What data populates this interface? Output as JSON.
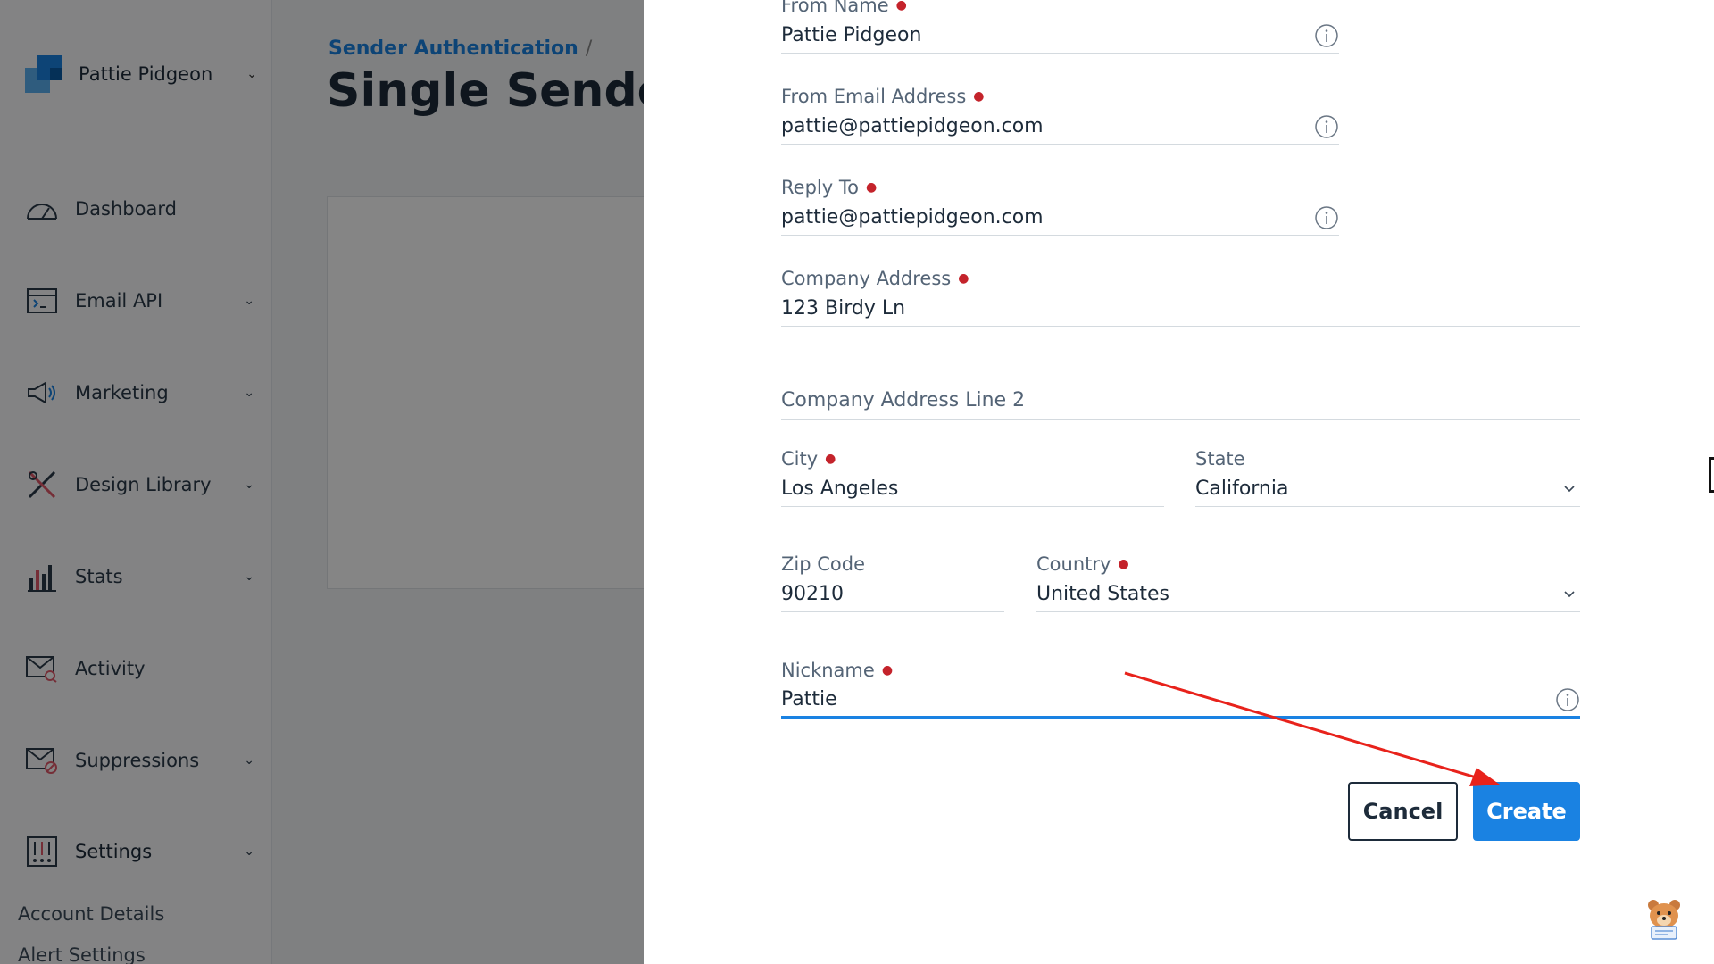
{
  "account": {
    "name": "Pattie Pidgeon"
  },
  "sidebar": {
    "items": [
      {
        "label": "Dashboard",
        "icon": "gauge-icon",
        "has_chevron": false
      },
      {
        "label": "Email API",
        "icon": "code-window-icon",
        "has_chevron": true
      },
      {
        "label": "Marketing",
        "icon": "megaphone-icon",
        "has_chevron": true
      },
      {
        "label": "Design Library",
        "icon": "tools-icon",
        "has_chevron": true
      },
      {
        "label": "Stats",
        "icon": "bar-chart-icon",
        "has_chevron": true
      },
      {
        "label": "Activity",
        "icon": "mail-search-icon",
        "has_chevron": false
      },
      {
        "label": "Suppressions",
        "icon": "mail-blocked-icon",
        "has_chevron": true
      },
      {
        "label": "Settings",
        "icon": "sliders-icon",
        "has_chevron": true
      }
    ],
    "sub_items": [
      "Account Details",
      "Alert Settings"
    ]
  },
  "breadcrumb": {
    "link": "Sender Authentication",
    "separator": "/"
  },
  "page": {
    "title": "Single Sender V"
  },
  "form": {
    "from_name": {
      "label": "From Name",
      "value": "Pattie Pidgeon"
    },
    "from_email": {
      "label": "From Email Address",
      "value": "pattie@pattiepidgeon.com"
    },
    "reply_to": {
      "label": "Reply To",
      "value": "pattie@pattiepidgeon.com"
    },
    "company_address": {
      "label": "Company Address",
      "value": "123 Birdy Ln"
    },
    "company_address_2": {
      "placeholder": "Company Address Line 2"
    },
    "city": {
      "label": "City",
      "value": "Los Angeles"
    },
    "state": {
      "label": "State",
      "value": "California"
    },
    "zip": {
      "label": "Zip Code",
      "value": "90210"
    },
    "country": {
      "label": "Country",
      "value": "United States"
    },
    "nickname": {
      "label": "Nickname",
      "value": "Pattie"
    }
  },
  "buttons": {
    "cancel": "Cancel",
    "create": "Create"
  },
  "colors": {
    "accent": "#1a82e2",
    "required": "#c4232b",
    "annotation_arrow": "#e8221b"
  }
}
